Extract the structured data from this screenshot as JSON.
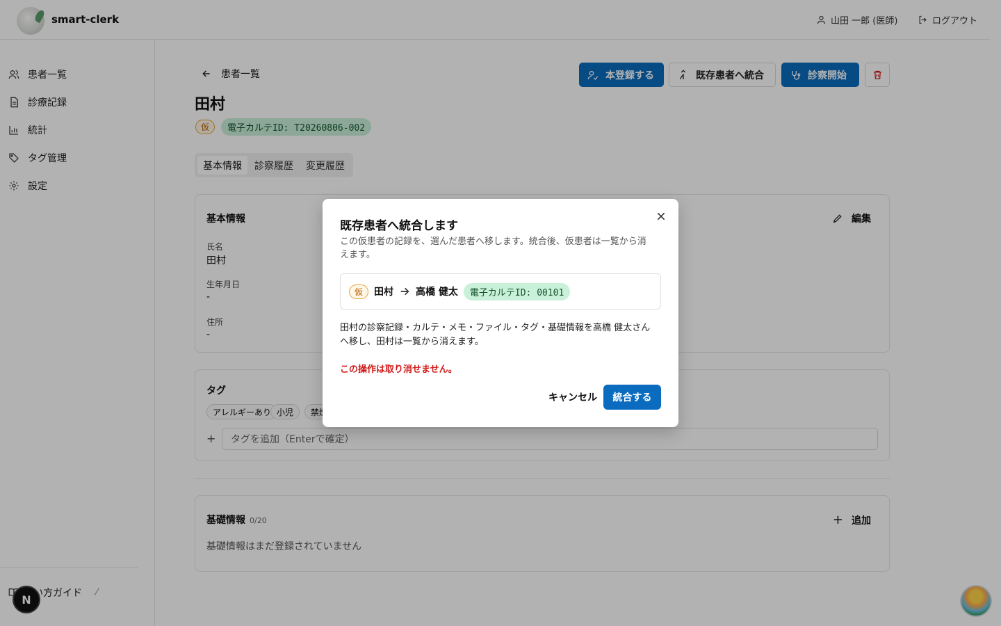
{
  "header": {
    "brand": "smart-clerk",
    "user": "山田 一郎 (医師)",
    "logout": "ログアウト"
  },
  "sidebar": {
    "items": [
      {
        "label": "患者一覧",
        "icon": "users-icon"
      },
      {
        "label": "診療記録",
        "icon": "document-icon"
      },
      {
        "label": "統計",
        "icon": "bar-chart-icon"
      },
      {
        "label": "タグ管理",
        "icon": "tag-icon"
      },
      {
        "label": "設定",
        "icon": "gear-icon"
      }
    ],
    "guide": "使い方ガイド"
  },
  "page": {
    "back_label": "患者一覧",
    "patient_name": "田村",
    "provisional_badge": "仮",
    "chart_id": "電子カルテID: T20260806-002",
    "actions": {
      "register": "本登録する",
      "merge": "既存患者へ統合",
      "start": "診察開始"
    },
    "tabs": [
      "基本情報",
      "診察履歴",
      "変更履歴"
    ],
    "basic": {
      "title": "基本情報",
      "edit": "編集",
      "name_label": "氏名",
      "name_value": "田村",
      "dob_label": "生年月日",
      "dob_value": "-",
      "address_label": "住所",
      "address_value": "-"
    },
    "tags": {
      "title": "タグ",
      "chips": [
        "アレルギーあり",
        "小児",
        "禁煙"
      ],
      "placeholder": "タグを追加（Enterで確定）"
    },
    "foundation": {
      "title": "基礎情報",
      "count": "0/20",
      "add": "追加",
      "empty": "基礎情報はまだ登録されていません"
    }
  },
  "dialog": {
    "title": "既存患者へ統合します",
    "description": "この仮患者の記録を、選んだ患者へ移します。統合後、仮患者は一覧から消えます。",
    "from_badge": "仮",
    "from_name": "田村",
    "to_name": "高橋 健太",
    "to_chart_id": "電子カルテID: 00101",
    "body": "田村の診察記録・カルテ・メモ・ファイル・タグ・基礎情報を高橋 健太さんへ移し、田村は一覧から消えます。",
    "warning": "この操作は取り消せません。",
    "cancel": "キャンセル",
    "confirm": "統合する"
  },
  "colors": {
    "primary": "#0b6cbf",
    "warning": "#d11a1a",
    "id_badge_bg": "#c9f0d8"
  }
}
